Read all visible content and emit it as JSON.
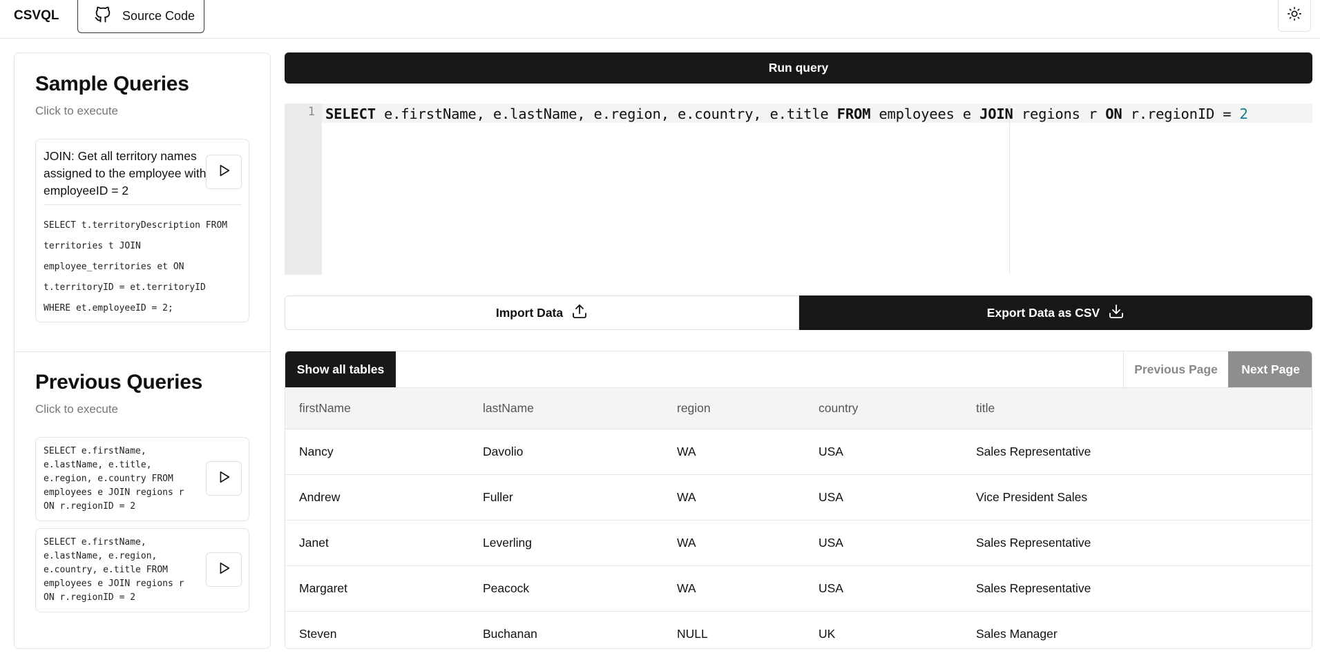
{
  "header": {
    "brand": "CSVQL",
    "source_code_label": "Source Code"
  },
  "sidebar": {
    "sample": {
      "title": "Sample Queries",
      "subtitle": "Click to execute",
      "card": {
        "title": "JOIN: Get all territory names assigned to the employee with employeeID = 2",
        "sql_lines": [
          "SELECT t.territoryDescription FROM",
          "territories t JOIN",
          "employee_territories et ON",
          "t.territoryID = et.territoryID",
          "WHERE et.employeeID = 2;"
        ]
      }
    },
    "previous": {
      "title": "Previous Queries",
      "subtitle": "Click to execute",
      "items": [
        {
          "sql_lines": [
            "SELECT e.firstName,",
            "e.lastName, e.title,",
            "e.region, e.country FROM",
            "employees e JOIN regions r",
            "ON r.regionID = 2"
          ]
        },
        {
          "sql_lines": [
            "SELECT e.firstName,",
            "e.lastName, e.region,",
            "e.country, e.title FROM",
            "employees e JOIN regions r",
            "ON r.regionID = 2"
          ]
        }
      ]
    }
  },
  "main": {
    "run_label": "Run query",
    "editor": {
      "line_number": "1",
      "tokens": [
        {
          "t": "SELECT",
          "k": "kw"
        },
        {
          "t": " e.firstName, e.lastName, e.region, e.country, e.title ",
          "k": ""
        },
        {
          "t": "FROM",
          "k": "kw"
        },
        {
          "t": " employees e ",
          "k": ""
        },
        {
          "t": "JOIN",
          "k": "kw"
        },
        {
          "t": " regions r ",
          "k": ""
        },
        {
          "t": "ON",
          "k": "kw"
        },
        {
          "t": " r.regionID = ",
          "k": ""
        },
        {
          "t": "2",
          "k": "num"
        }
      ]
    },
    "import_label": "Import Data",
    "export_label": "Export Data as CSV",
    "results": {
      "show_tables_label": "Show all tables",
      "previous_page_label": "Previous Page",
      "next_page_label": "Next Page",
      "columns": [
        "firstName",
        "lastName",
        "region",
        "country",
        "title"
      ],
      "rows": [
        [
          "Nancy",
          "Davolio",
          "WA",
          "USA",
          "Sales Representative"
        ],
        [
          "Andrew",
          "Fuller",
          "WA",
          "USA",
          "Vice President Sales"
        ],
        [
          "Janet",
          "Leverling",
          "WA",
          "USA",
          "Sales Representative"
        ],
        [
          "Margaret",
          "Peacock",
          "WA",
          "USA",
          "Sales Representative"
        ],
        [
          "Steven",
          "Buchanan",
          "NULL",
          "UK",
          "Sales Manager"
        ]
      ]
    }
  },
  "colors": {
    "primary_dark": "#18181b",
    "disabled_button": "#8e8e8e",
    "border": "#e4e4e4",
    "number_token": "#0f7c8c"
  },
  "icons": [
    "github-icon",
    "sun-icon",
    "play-icon",
    "upload-icon",
    "download-icon"
  ]
}
